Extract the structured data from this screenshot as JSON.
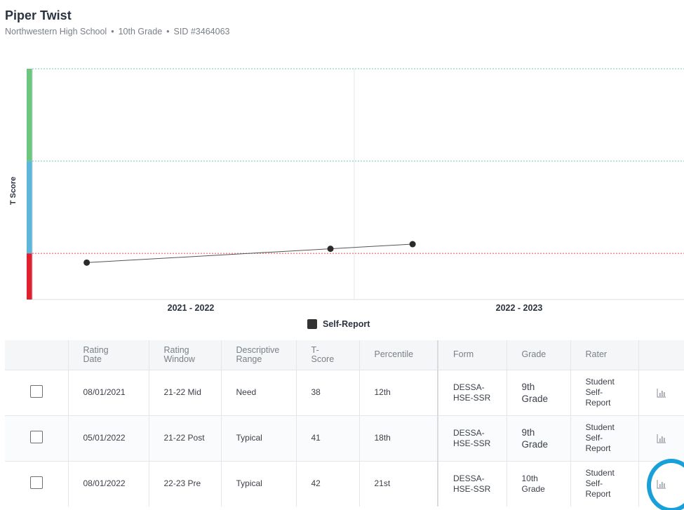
{
  "student": {
    "name": "Piper Twist",
    "school": "Northwestern High School",
    "grade": "10th Grade",
    "sid": "SID #3464063",
    "separator": "•"
  },
  "chart_data": {
    "type": "line",
    "ylabel": "T Score",
    "x_labels": [
      "2021 - 2022",
      "2022 - 2023"
    ],
    "series": [
      {
        "name": "Self-Report",
        "points": [
          {
            "date": "08/01/2021",
            "t_score": 38
          },
          {
            "date": "05/01/2022",
            "t_score": 41
          },
          {
            "date": "08/01/2022",
            "t_score": 42
          }
        ]
      }
    ],
    "bands": [
      {
        "range": "strength",
        "color": "#6cc77e"
      },
      {
        "range": "typical",
        "color": "#5bb8dc"
      },
      {
        "range": "need",
        "color": "#e0202e"
      }
    ],
    "threshold_colors": {
      "strength": "#8fd0c8",
      "need": "#e88080"
    },
    "legend_placement": "bottom-center",
    "point_color": "#2b2b2b"
  },
  "legend": {
    "label": "Self-Report"
  },
  "table": {
    "headers": {
      "rating_date": [
        "Rating",
        "Date"
      ],
      "rating_window": [
        "Rating",
        "Window"
      ],
      "descriptive_range": [
        "Descriptive",
        "Range"
      ],
      "t_score": [
        "T-",
        "Score"
      ],
      "percentile": "Percentile",
      "form": "Form",
      "grade": "Grade",
      "rater": "Rater"
    },
    "rows": [
      {
        "date": "08/01/2021",
        "window": "21-22 Mid",
        "range": "Need",
        "tscore": "38",
        "percentile": "12th",
        "form": [
          "DESSA-",
          "HSE-SSR"
        ],
        "grade": [
          "9th",
          "Grade"
        ],
        "rater": [
          "Student",
          "Self-",
          "Report"
        ]
      },
      {
        "date": "05/01/2022",
        "window": "21-22 Post",
        "range": "Typical",
        "tscore": "41",
        "percentile": "18th",
        "form": [
          "DESSA-",
          "HSE-SSR"
        ],
        "grade": [
          "9th",
          "Grade"
        ],
        "rater": [
          "Student",
          "Self-",
          "Report"
        ]
      },
      {
        "date": "08/01/2022",
        "window": "22-23 Pre",
        "range": "Typical",
        "tscore": "42",
        "percentile": "21st",
        "form": [
          "DESSA-",
          "HSE-SSR"
        ],
        "grade": [
          "10th",
          "Grade"
        ],
        "rater": [
          "Student",
          "Self-",
          "Report"
        ]
      }
    ]
  },
  "icons": {
    "row_action": "bar-chart-icon",
    "checkbox": "checkbox"
  },
  "colors": {
    "accent_ring": "#1aa0d8",
    "icon_gray": "#9aa0a8"
  }
}
